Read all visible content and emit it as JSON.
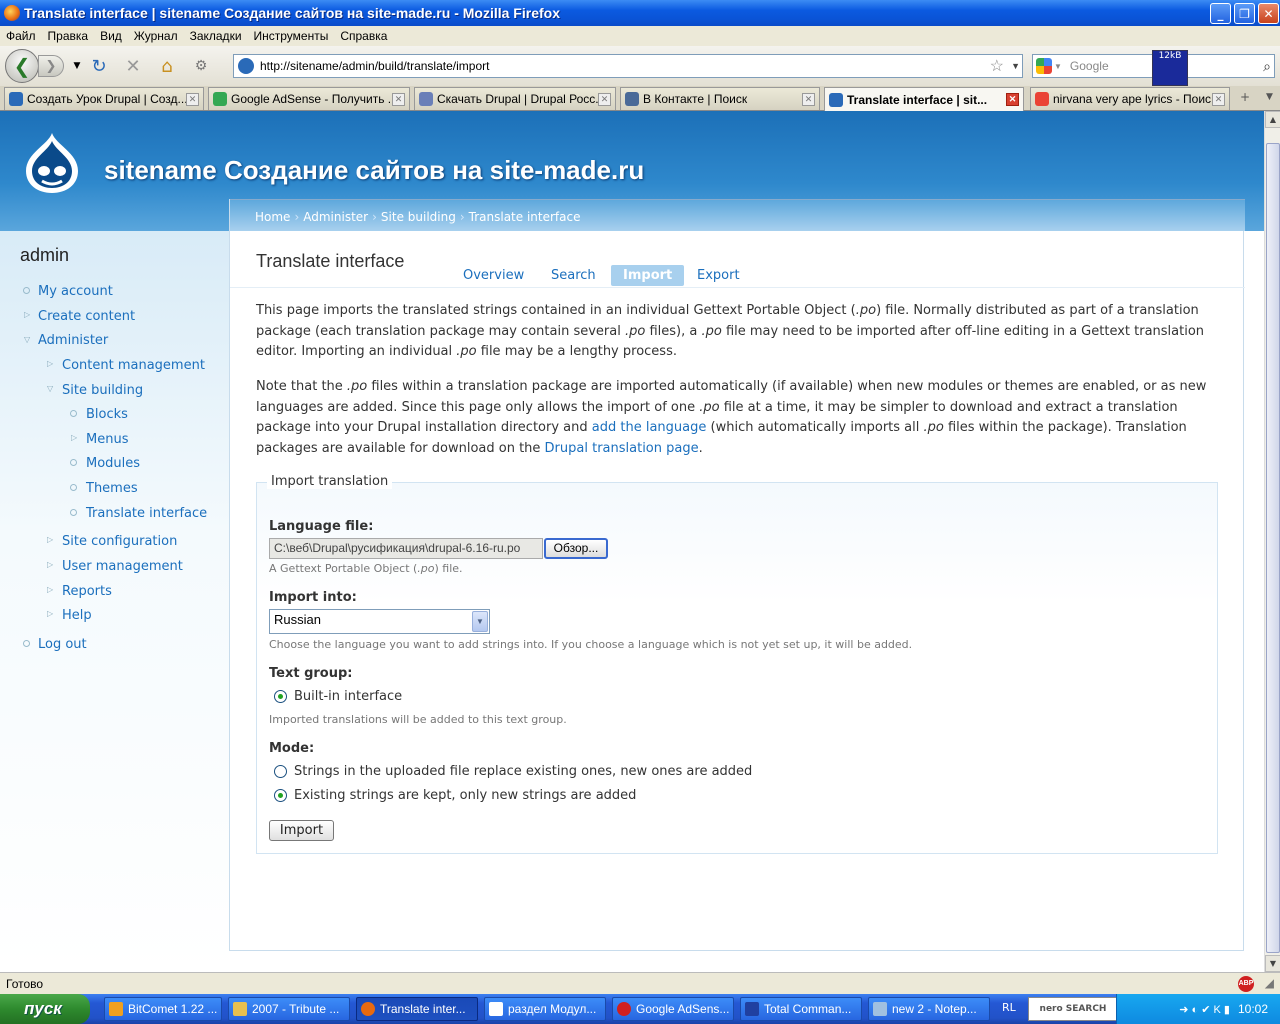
{
  "window": {
    "title": "Translate interface | sitename Создание сайтов на site-made.ru - Mozilla Firefox"
  },
  "menu": [
    "Файл",
    "Правка",
    "Вид",
    "Журнал",
    "Закладки",
    "Инструменты",
    "Справка"
  ],
  "toolbar": {
    "url": "http://sitename/admin/build/translate/import",
    "search_placeholder": "Google",
    "netmon_label": "12kB"
  },
  "tabs": [
    {
      "label": "Создать Урок Drupal | Созд...",
      "color": "#2a6ab8"
    },
    {
      "label": "Google AdSense - Получить ...",
      "color": "#34a853"
    },
    {
      "label": "Скачать Drupal | Drupal Росс...",
      "color": "#6a7fb8"
    },
    {
      "label": "В Контакте | Поиск",
      "color": "#4a6a98"
    },
    {
      "label": "Translate interface | sit...",
      "color": "#2a6ab8"
    },
    {
      "label": "nirvana very ape lyrics - Поис...",
      "color": "#ea4335"
    }
  ],
  "site": {
    "name": "sitename Создание сайтов на site-made.ru"
  },
  "breadcrumb": [
    "Home",
    "Administer",
    "Site building",
    "Translate interface"
  ],
  "sidebar": {
    "title": "admin",
    "items": {
      "my_account": "My account",
      "create_content": "Create content",
      "administer": "Administer",
      "content_management": "Content management",
      "site_building": "Site building",
      "blocks": "Blocks",
      "menus": "Menus",
      "modules": "Modules",
      "themes": "Themes",
      "translate_interface": "Translate interface",
      "site_configuration": "Site configuration",
      "user_management": "User management",
      "reports": "Reports",
      "help": "Help",
      "log_out": "Log out"
    }
  },
  "page": {
    "title": "Translate interface",
    "local_tabs": [
      "Overview",
      "Search",
      "Import",
      "Export"
    ],
    "intro1": {
      "a": "This page imports the translated strings contained in an individual Gettext Portable Object (",
      "b": ".po",
      "c": ") file. Normally distributed as part of a translation package (each translation package may contain several ",
      "d": ".po",
      "e": " files), a ",
      "f": ".po",
      "g": " file may need to be imported after off-line editing in a Gettext translation editor. Importing an individual ",
      "h": ".po",
      "i": " file may be a lengthy process."
    },
    "intro2": {
      "a": "Note that the ",
      "b": ".po",
      "c": " files within a translation package are imported automatically (if available) when new modules or themes are enabled, or as new languages are added. Since this page only allows the import of one ",
      "d": ".po",
      "e": " file at a time, it may be simpler to download and extract a translation package into your Drupal installation directory and ",
      "link1": "add the language",
      "f": " (which automatically imports all ",
      "g": ".po",
      "h": " files within the package). Translation packages are available for download on the ",
      "link2": "Drupal translation page",
      "i": "."
    }
  },
  "form": {
    "legend": "Import translation",
    "file_label": "Language file:",
    "file_value": "C:\\веб\\Drupal\\русификация\\drupal-6.16-ru.po",
    "browse_label": "Обзор...",
    "file_desc_a": "A Gettext Portable Object (",
    "file_desc_b": ".po",
    "file_desc_c": ") file.",
    "import_into_label": "Import into:",
    "import_into_value": "Russian",
    "import_into_desc": "Choose the language you want to add strings into. If you choose a language which is not yet set up, it will be added.",
    "group_label": "Text group:",
    "group_option": "Built-in interface",
    "group_desc": "Imported translations will be added to this text group.",
    "mode_label": "Mode:",
    "mode_option1": "Strings in the uploaded file replace existing ones, new ones are added",
    "mode_option2": "Existing strings are kept, only new strings are added",
    "submit": "Import"
  },
  "status": "Готово",
  "taskbar": {
    "start": "пуск",
    "tasks": [
      {
        "label": "BitComet 1.22 ...",
        "color": "#f0a020"
      },
      {
        "label": "2007 - Tribute ...",
        "color": "#e8c050"
      },
      {
        "label": "Translate inter...",
        "color": "#e86a10"
      },
      {
        "label": "раздел Модул...",
        "color": "#ffffff"
      },
      {
        "label": "Google AdSens...",
        "color": "#d02020"
      },
      {
        "label": "Total Comman...",
        "color": "#2040a0"
      },
      {
        "label": "new 2 - Notep...",
        "color": "#a0c0e0"
      }
    ],
    "lang": "RL",
    "nero": "nero SEARCH",
    "clock": "10:02"
  }
}
